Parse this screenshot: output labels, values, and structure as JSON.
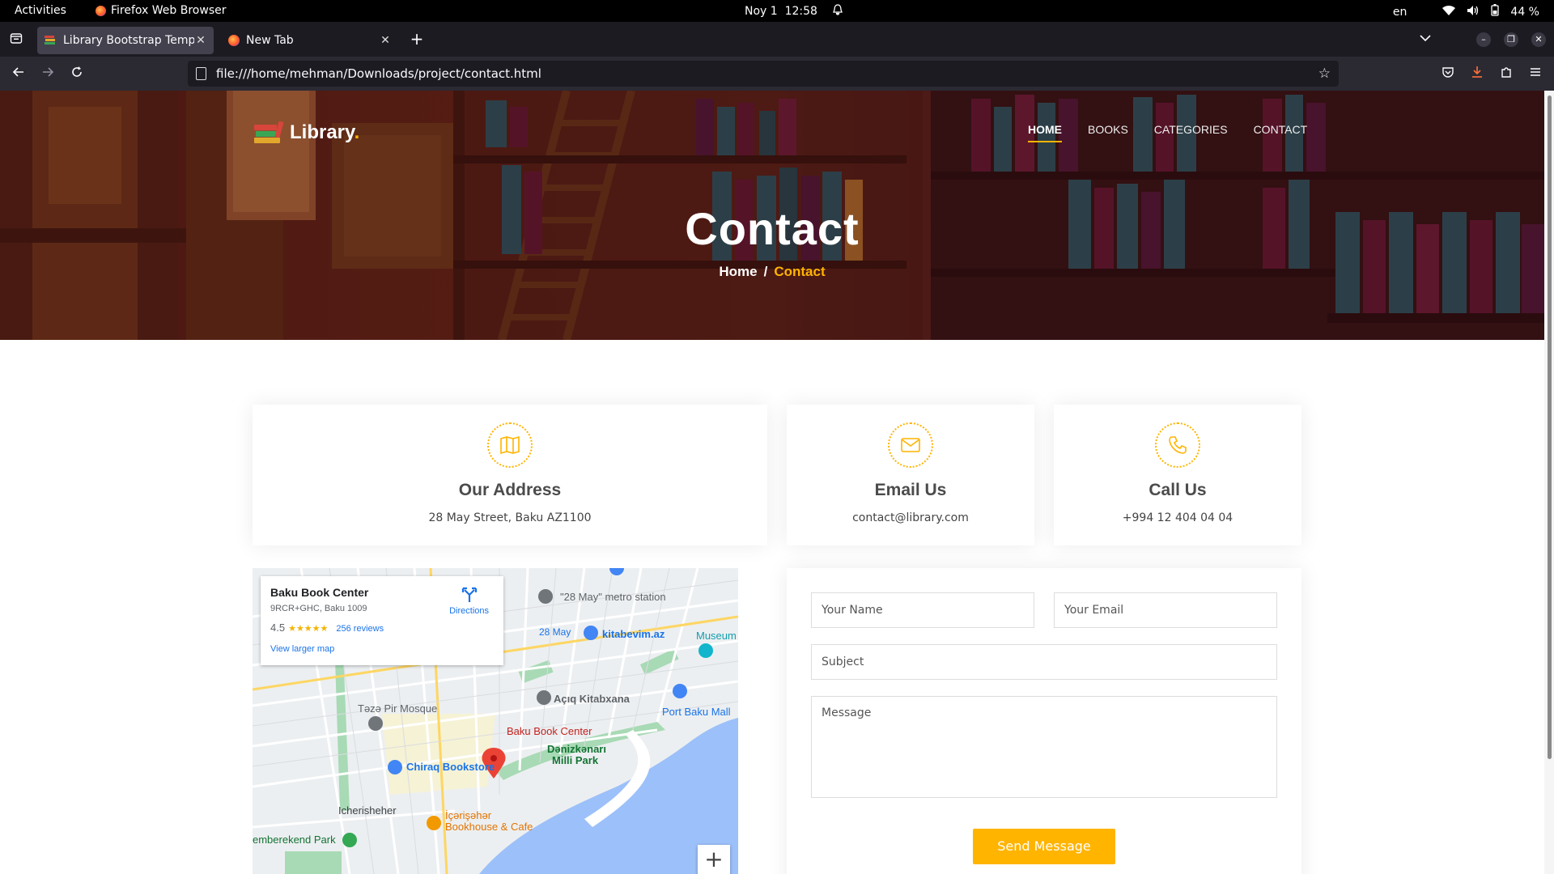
{
  "system": {
    "activities": "Activities",
    "app_name": "Firefox Web Browser",
    "date": "Noy 1",
    "time": "12:58",
    "language": "en",
    "battery": "44 %"
  },
  "browser": {
    "tabs": [
      {
        "title": "Library Bootstrap Template",
        "active": true
      },
      {
        "title": "New Tab",
        "active": false
      }
    ],
    "url": "file:///home/mehman/Downloads/project/contact.html"
  },
  "site": {
    "logo_text": "Library",
    "logo_dot": ".",
    "nav": [
      {
        "label": "HOME",
        "active": true
      },
      {
        "label": "BOOKS",
        "active": false
      },
      {
        "label": "CATEGORIES",
        "active": false
      },
      {
        "label": "CONTACT",
        "active": false
      }
    ],
    "hero": {
      "title": "Contact",
      "breadcrumb_home": "Home",
      "breadcrumb_sep": "/",
      "breadcrumb_current": "Contact"
    },
    "cards": [
      {
        "icon": "map-icon",
        "title": "Our Address",
        "text": "28 May Street, Baku AZ1100"
      },
      {
        "icon": "envelope-icon",
        "title": "Email Us",
        "text": "contact@library.com"
      },
      {
        "icon": "phone-icon",
        "title": "Call Us",
        "text": "+994 12 404 04 04"
      }
    ],
    "map": {
      "place_name": "Baku Book Center",
      "address": "9RCR+GHC, Baku 1009",
      "rating": "4.5",
      "stars": "★★★★★",
      "reviews": "256 reviews",
      "larger_map": "View larger map",
      "directions": "Directions",
      "labels": {
        "metro": "\"28 May\" metro station",
        "may28": "28 May",
        "kitabevim": "kitabevim.az",
        "museum": "Museum",
        "acig": "Açıq Kitabxana",
        "taza_pir": "Təzə Pir Mosque",
        "port_baku": "Port Baku Mall",
        "baku_book": "Baku Book Center",
        "chiraq": "Chiraq Bookstore",
        "danizkanari": "Dənizkənarı",
        "milli_park": "Milli Park",
        "icherisheher": "Icherisheher",
        "icerisehar_book": "İçərişəhər",
        "bookhouse": "Bookhouse & Cafe",
        "emberekend": "emberekend Park",
        "zoom_in": "+"
      }
    },
    "form": {
      "name_placeholder": "Your Name",
      "email_placeholder": "Your Email",
      "subject_placeholder": "Subject",
      "message_placeholder": "Message",
      "send_label": "Send Message"
    },
    "colors": {
      "accent": "#ffb400",
      "heading": "#4b4b4b"
    }
  }
}
